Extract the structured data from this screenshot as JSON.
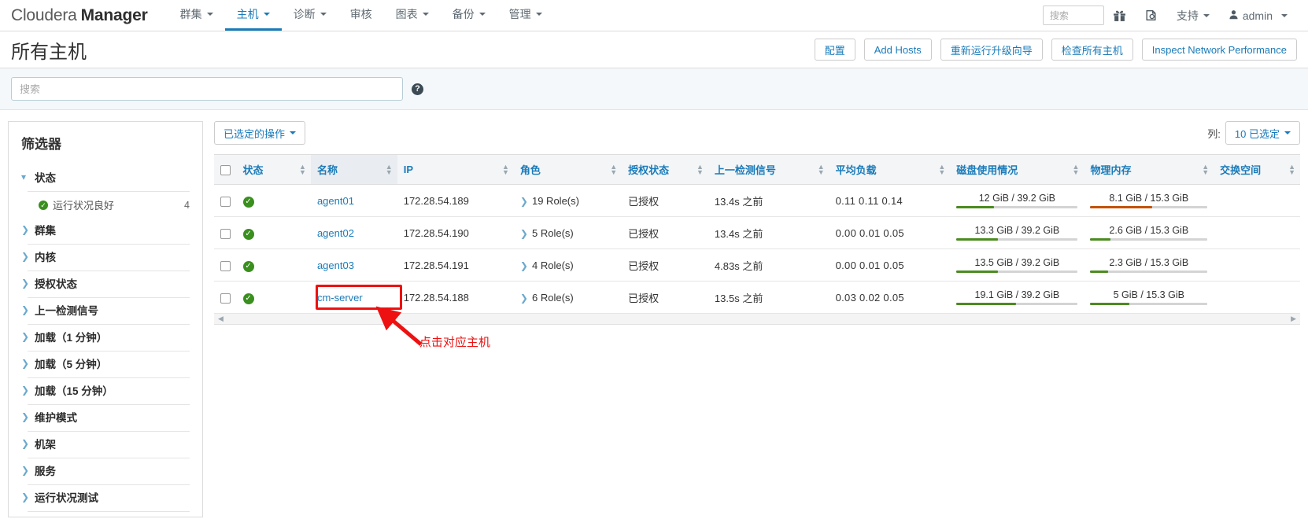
{
  "navbar": {
    "brand_light": "Cloudera",
    "brand_bold": "Manager",
    "items": [
      {
        "label": "群集",
        "caret": true,
        "active": false
      },
      {
        "label": "主机",
        "caret": true,
        "active": true
      },
      {
        "label": "诊断",
        "caret": true,
        "active": false
      },
      {
        "label": "审核",
        "caret": false,
        "active": false
      },
      {
        "label": "图表",
        "caret": true,
        "active": false
      },
      {
        "label": "备份",
        "caret": true,
        "active": false
      },
      {
        "label": "管理",
        "caret": true,
        "active": false
      }
    ],
    "search_placeholder": "搜索",
    "search_value": "",
    "gift_icon": "gift-icon",
    "parcel_icon": "parcel-icon",
    "support_label": "支持",
    "user_label": "admin"
  },
  "header": {
    "title": "所有主机",
    "buttons": [
      {
        "label": "配置",
        "name": "configure-button"
      },
      {
        "label": "Add Hosts",
        "name": "add-hosts-button"
      },
      {
        "label": "重新运行升级向导",
        "name": "rerun-upgrade-wizard-button"
      },
      {
        "label": "检查所有主机",
        "name": "inspect-all-hosts-button"
      },
      {
        "label": "Inspect Network Performance",
        "name": "inspect-network-performance-button"
      }
    ]
  },
  "search": {
    "placeholder": "搜索",
    "value": "",
    "help_icon": "help-icon",
    "help_glyph": "?"
  },
  "sidebar": {
    "title": "筛选器",
    "groups": [
      {
        "label": "状态",
        "expanded": true,
        "options": [
          {
            "label": "运行状况良好",
            "count": "4",
            "status": "good"
          }
        ]
      },
      {
        "label": "群集",
        "expanded": false,
        "options": []
      },
      {
        "label": "内核",
        "expanded": false,
        "options": []
      },
      {
        "label": "授权状态",
        "expanded": false,
        "options": []
      },
      {
        "label": "上一检测信号",
        "expanded": false,
        "options": []
      },
      {
        "label": "加载（1 分钟）",
        "expanded": false,
        "options": []
      },
      {
        "label": "加载（5 分钟）",
        "expanded": false,
        "options": []
      },
      {
        "label": "加载（15 分钟）",
        "expanded": false,
        "options": []
      },
      {
        "label": "维护模式",
        "expanded": false,
        "options": []
      },
      {
        "label": "机架",
        "expanded": false,
        "options": []
      },
      {
        "label": "服务",
        "expanded": false,
        "options": []
      },
      {
        "label": "运行状况测试",
        "expanded": false,
        "options": []
      }
    ]
  },
  "toolbar": {
    "selected_actions_label": "已选定的操作",
    "columns_label": "列:",
    "columns_value": "10 已选定"
  },
  "table": {
    "columns": [
      {
        "label": "状态",
        "sortable": true,
        "name": "column-status"
      },
      {
        "label": "名称",
        "sortable": true,
        "name": "column-name",
        "selected": true
      },
      {
        "label": "IP",
        "sortable": true,
        "name": "column-ip"
      },
      {
        "label": "角色",
        "sortable": true,
        "name": "column-roles"
      },
      {
        "label": "授权状态",
        "sortable": true,
        "name": "column-auth-state"
      },
      {
        "label": "上一检测信号",
        "sortable": true,
        "name": "column-last-heartbeat"
      },
      {
        "label": "平均负载",
        "sortable": true,
        "name": "column-load-average"
      },
      {
        "label": "磁盘使用情况",
        "sortable": true,
        "name": "column-disk-usage"
      },
      {
        "label": "物理内存",
        "sortable": true,
        "name": "column-physical-memory"
      },
      {
        "label": "交换空间",
        "sortable": true,
        "name": "column-swap-space"
      }
    ],
    "rows": [
      {
        "status": "good",
        "name": "agent01",
        "ip": "172.28.54.189",
        "roles": "19 Role(s)",
        "auth_state": "已授权",
        "last_heartbeat": "13.4s 之前",
        "load_average": "0.11  0.11  0.14",
        "disk_usage": {
          "label": "12 GiB / 39.2 GiB",
          "percent": 31,
          "color": "#4b8b1f"
        },
        "physical_memory": {
          "label": "8.1 GiB / 15.3 GiB",
          "percent": 53,
          "color": "#c35209"
        },
        "swap_space": {
          "label": "",
          "percent": 0,
          "color": "#4b8b1f"
        }
      },
      {
        "status": "good",
        "name": "agent02",
        "ip": "172.28.54.190",
        "roles": "5 Role(s)",
        "auth_state": "已授权",
        "last_heartbeat": "13.4s 之前",
        "load_average": "0.00  0.01  0.05",
        "disk_usage": {
          "label": "13.3 GiB / 39.2 GiB",
          "percent": 34,
          "color": "#4b8b1f"
        },
        "physical_memory": {
          "label": "2.6 GiB / 15.3 GiB",
          "percent": 17,
          "color": "#4b8b1f"
        },
        "swap_space": {
          "label": "",
          "percent": 0,
          "color": "#4b8b1f"
        }
      },
      {
        "status": "good",
        "name": "agent03",
        "ip": "172.28.54.191",
        "roles": "4 Role(s)",
        "auth_state": "已授权",
        "last_heartbeat": "4.83s 之前",
        "load_average": "0.00  0.01  0.05",
        "disk_usage": {
          "label": "13.5 GiB / 39.2 GiB",
          "percent": 34,
          "color": "#4b8b1f"
        },
        "physical_memory": {
          "label": "2.3 GiB / 15.3 GiB",
          "percent": 15,
          "color": "#4b8b1f"
        },
        "swap_space": {
          "label": "",
          "percent": 0,
          "color": "#4b8b1f"
        }
      },
      {
        "status": "good",
        "name": "cm-server",
        "ip": "172.28.54.188",
        "roles": "6 Role(s)",
        "auth_state": "已授权",
        "last_heartbeat": "13.5s 之前",
        "load_average": "0.03  0.02  0.05",
        "disk_usage": {
          "label": "19.1 GiB / 39.2 GiB",
          "percent": 49,
          "color": "#4b8b1f"
        },
        "physical_memory": {
          "label": "5 GiB / 15.3 GiB",
          "percent": 33,
          "color": "#4b8b1f"
        },
        "swap_space": {
          "label": "",
          "percent": 0,
          "color": "#4b8b1f"
        }
      }
    ]
  },
  "annotation": {
    "text": "点击对应主机",
    "color": "#ee1111",
    "highlight_target": "cm-server"
  },
  "colors": {
    "link": "#1a7bb9",
    "good_green": "#3a8f1e",
    "meter_green": "#4b8b1f",
    "meter_orange": "#c35209",
    "annotation_red": "#ee1111"
  }
}
